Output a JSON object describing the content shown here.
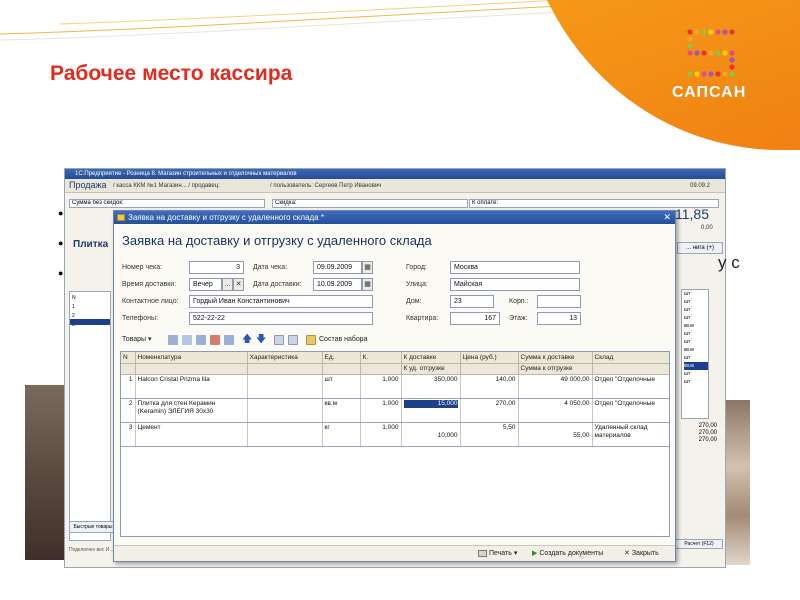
{
  "slide": {
    "title": "Рабочее место кассира",
    "logo_text": "САПСАН",
    "trailing_text": "у с"
  },
  "main_window": {
    "title": "1С:Предприятие - Розница 8. Магазин строительных и отделочных материалов",
    "section": "Продажа",
    "header_cashbox": "/ касса ККМ №1 Магазин... / продавец:",
    "header_user": "/ пользователь: Сергеев Петр Иванович",
    "header_date": "09.09.2",
    "sum_no_discount_label": "Сумма без скидок:",
    "discount_label": "Скидка:",
    "to_pay_label": "К оплате:",
    "item_preview": "Плитка",
    "amount": "11,85",
    "amount_zero": "0,00",
    "right_button": "... нига (+)",
    "list_rows": [
      "N",
      "1",
      "2",
      "3"
    ],
    "right_units": [
      "шт",
      "шт",
      "шт",
      "шт",
      "кв.м",
      "шт",
      "шт",
      "кв.м",
      "шт",
      "кв.м",
      "шт",
      "шт"
    ],
    "right_totals": [
      "270,00",
      "270,00",
      "270,00"
    ],
    "quick_goods_label": "Быстрые товары",
    "status_text": "Подключен вес И...",
    "f12_label": "Расчет (F12)"
  },
  "dialog": {
    "window_title": "Заявка на доставку и отгрузку с удаленного склада *",
    "heading": "Заявка на доставку и отгрузку с удаленного склада",
    "labels": {
      "check_no": "Номер чека:",
      "date_check": "Дата чека:",
      "city": "Город:",
      "delivery_time": "Время доставки:",
      "delivery_date": "Дата доставки:",
      "street": "Улица:",
      "contact": "Контактное лицо:",
      "house": "Дом:",
      "building": "Корп.:",
      "phones": "Телефоны:",
      "flat": "Квартира:",
      "floor": "Этаж:"
    },
    "values": {
      "check_no": "3",
      "date_check": "09.09.2009",
      "city": "Москва",
      "delivery_time": "Вечер",
      "delivery_date": "10.09.2009",
      "street": "Майская",
      "contact": "Гордый Иван Константинович",
      "house": "23",
      "building": "",
      "phones": "522-22-22",
      "flat": "167",
      "floor": "13"
    },
    "toolbar": {
      "goods_menu": "Товары",
      "set_composition": "Состав набора"
    },
    "table": {
      "headers": [
        "N",
        "Номенклатура",
        "Характеристика",
        "Ед.",
        "К.",
        "К доставке",
        "Цена (руб.)",
        "Сумма к доставке",
        "Склад"
      ],
      "subheaders": [
        "К уд. отгрузке",
        "Сумма к отгрузке"
      ],
      "rows": [
        {
          "n": "1",
          "name": "Halcon Cristal Prizma lila",
          "char": "",
          "unit": "шт",
          "k": "1,000",
          "deliver": "350,000",
          "ship": "",
          "price": "140,00",
          "sum_deliver": "49 000,00",
          "sum_ship": "",
          "warehouse": "Отдел \"Отделочные"
        },
        {
          "n": "2",
          "name": "Плитка для стен Керамин (Keramin) ЭЛЕГИЯ 30х30",
          "char": "",
          "unit": "кв.м",
          "k": "1,000",
          "deliver": "15,000",
          "ship": "",
          "price": "270,00",
          "sum_deliver": "4 050,00",
          "sum_ship": "",
          "warehouse": "Отдел \"Отделочные"
        },
        {
          "n": "3",
          "name": "Цемент",
          "char": "",
          "unit": "кг",
          "k": "1,000",
          "deliver": "",
          "ship": "10,000",
          "price": "5,50",
          "sum_deliver": "",
          "sum_ship": "55,00",
          "warehouse": "Удаленный склад материалов"
        }
      ]
    },
    "footer": {
      "print": "Печать",
      "create_docs": "Создать документы",
      "close": "Закрыть"
    }
  },
  "colors": {
    "title_red": "#e12b1f",
    "orange": "#f39219",
    "titlebar_blue": "#2c58a6",
    "selection_blue": "#1e3f8a"
  }
}
